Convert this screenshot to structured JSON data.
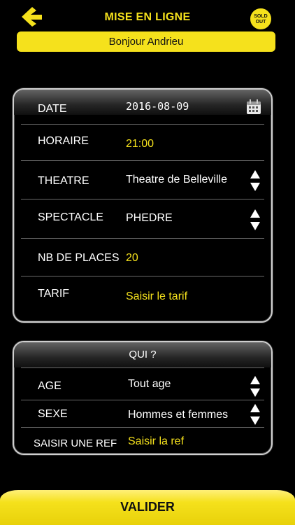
{
  "header": {
    "title": "MISE EN LIGNE",
    "back_icon": "back-chevron-icon",
    "logo_top": "SOLD",
    "logo_bottom": "OUT",
    "greeting": "Bonjour Andrieu"
  },
  "form": {
    "date": {
      "label": "DATE",
      "value": "2016-08-09",
      "icon": "calendar-icon"
    },
    "horaire": {
      "label": "HORAIRE",
      "value": "21:00"
    },
    "theatre": {
      "label": "THEATRE",
      "value": "Theatre de Belleville"
    },
    "spectacle": {
      "label": "SPECTACLE",
      "value": "PHEDRE"
    },
    "places": {
      "label": "NB DE PLACES",
      "value": "20"
    },
    "tarif": {
      "label": "TARIF",
      "value": "Saisir le tarif"
    }
  },
  "qui": {
    "title": "QUI ?",
    "age": {
      "label": "AGE",
      "value": "Tout age"
    },
    "sexe": {
      "label": "SEXE",
      "value": "Hommes et femmes"
    },
    "ref": {
      "label": "SAISIR UNE REF",
      "value": "Saisir la ref"
    }
  },
  "footer": {
    "submit_label": "VALIDER"
  },
  "colors": {
    "accent": "#f5e11c",
    "background": "#000000",
    "text": "#ffffff"
  }
}
